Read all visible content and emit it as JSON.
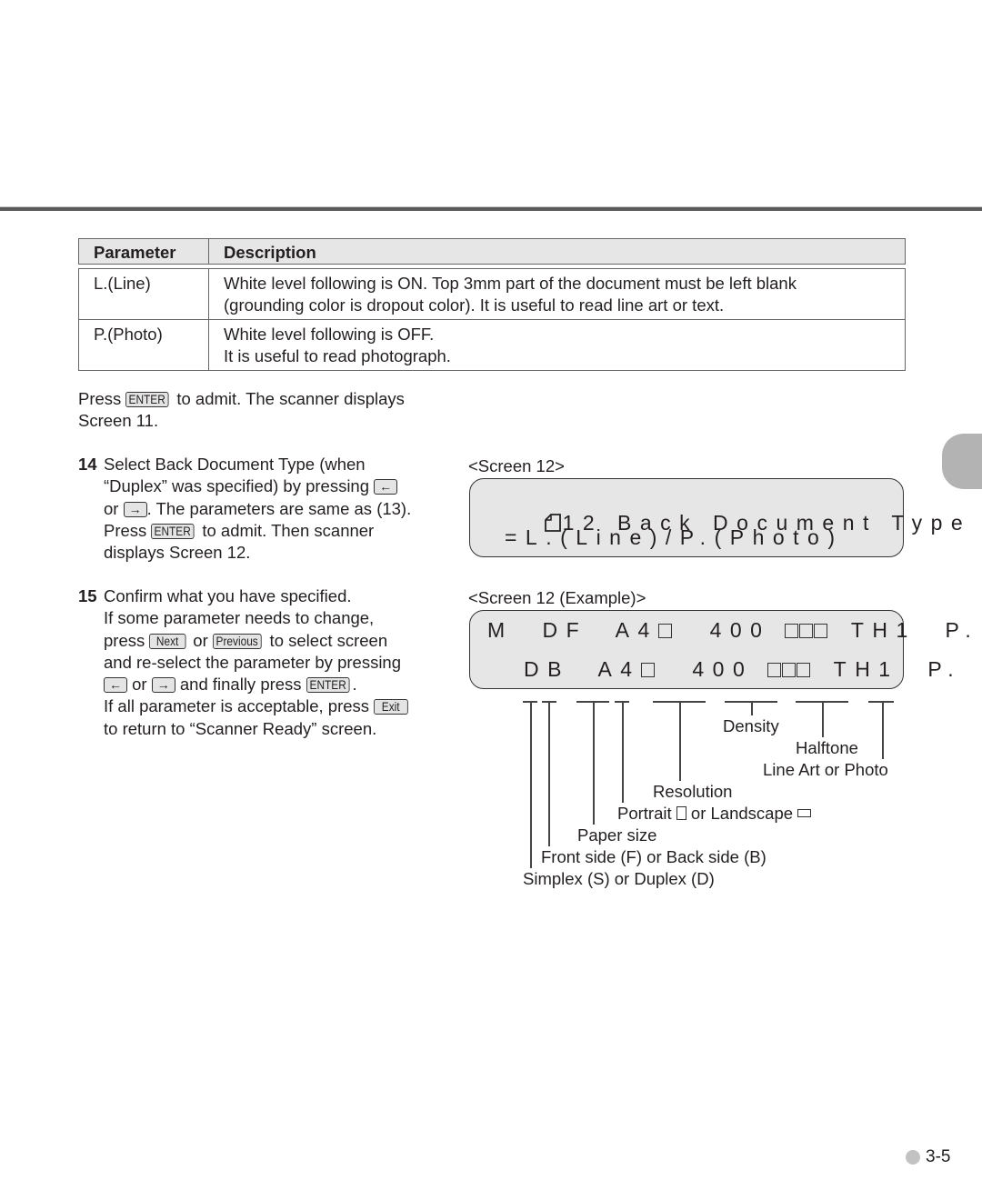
{
  "table": {
    "headers": [
      "Parameter",
      "Description"
    ],
    "rows": [
      {
        "parameter": "L.(Line)",
        "description": [
          "White level following is ON. Top 3mm part of the document must be left blank",
          "(grounding color is dropout color). It is useful to read line art or text."
        ]
      },
      {
        "parameter": "P.(Photo)",
        "description": [
          "White level following is OFF.",
          "It is useful to read photograph."
        ]
      }
    ]
  },
  "intro": {
    "press": "Press",
    "enter_key": "ENTER",
    "after_enter": " to admit. The scanner displays",
    "line2": "Screen 11."
  },
  "step14": {
    "number": "14",
    "line1": "Select Back Document Type (when",
    "line2": "“Duplex” was specified) by pressing ",
    "left_key": "←",
    "line3_or": "or ",
    "right_key": "→",
    "line3_rest": ". The parameters are same as (13).",
    "line4_press": "Press ",
    "enter_key": "ENTER",
    "line4_rest": " to admit. Then scanner",
    "line5": "displays Screen 12."
  },
  "step15": {
    "number": "15",
    "line1": "Confirm what you have specified.",
    "line2": "If some parameter needs to change,",
    "line3_press": "press ",
    "next_key": "Next",
    "line3_or": " or ",
    "previous_key": "Previous",
    "line3_rest": " to select screen",
    "line4": "and re-select the parameter by pressing",
    "left_key": "←",
    "line5_or": " or ",
    "right_key": "→",
    "line5_rest": " and finally press ",
    "enter_key": "ENTER",
    "line5_end": ".",
    "line6": "If all parameter is acceptable, press ",
    "exit_key": "Exit",
    "line7": "to return to “Scanner Ready” screen."
  },
  "screen12": {
    "label": "<Screen 12>",
    "line1_icon": "page-corner-icon",
    "line1": "12 Back Document Type",
    "line2": "=L.(Line)/P.(Photo)"
  },
  "screen12_example": {
    "label": "<Screen 12 (Example)>",
    "line1": {
      "mode": "M",
      "side": "DF",
      "size": "A4",
      "resolution": "400",
      "halftone": "TH1",
      "type": "P."
    },
    "line2": {
      "mode": "",
      "side": "DB",
      "size": "A4",
      "resolution": "400",
      "halftone": "TH1",
      "type": "P."
    }
  },
  "annotations": {
    "density": "Density",
    "halftone": "Halftone",
    "line_art_photo": "Line Art or Photo",
    "resolution": "Resolution",
    "orientation_pre": "Portrait ",
    "orientation_mid": " or Landscape ",
    "paper_size": "Paper size",
    "side": "Front side (F) or Back side (B)",
    "mode": "Simplex (S) or Duplex (D)"
  },
  "footer": {
    "page_number": "3-5"
  }
}
